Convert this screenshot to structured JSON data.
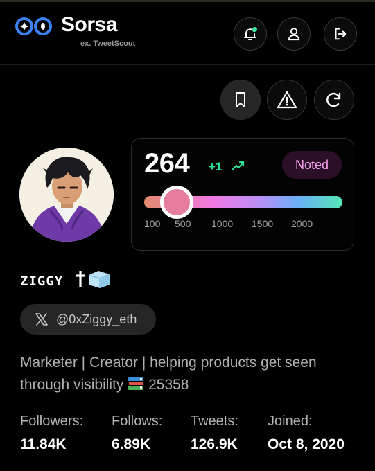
{
  "brand": {
    "name": "Sorsa",
    "subtitle": "ex. TweetScout"
  },
  "header_buttons": [
    {
      "icon": "notification-bell-icon"
    },
    {
      "icon": "user-icon"
    },
    {
      "icon": "logout-icon"
    }
  ],
  "actions": [
    {
      "icon": "bookmark-icon"
    },
    {
      "icon": "warning-icon"
    },
    {
      "icon": "refresh-icon"
    }
  ],
  "score": {
    "value": "264",
    "delta": "+1",
    "badge": "Noted",
    "level_fraction": 0.1,
    "ticks": [
      "100",
      "500",
      "1000",
      "1500",
      "2000"
    ]
  },
  "profile": {
    "display_name": "ZIGGY",
    "handle": "@0xZiggy_eth",
    "bio_line1": "Marketer | Creator | helping products get seen",
    "bio_line2_a": "through visibility",
    "bio_line2_b": "25358"
  },
  "stats": [
    {
      "label": "Followers:",
      "value": "11.84K"
    },
    {
      "label": "Follows:",
      "value": "6.89K"
    },
    {
      "label": "Tweets:",
      "value": "126.9K"
    },
    {
      "label": "Joined:",
      "value": "Oct 8, 2020"
    }
  ],
  "colors": {
    "accent_green": "#2fe39a",
    "badge_text": "#f6a0ee",
    "badge_bg": "#2a0f26",
    "thumb": "#e77d9c",
    "logo_blue": "#3b82f6"
  }
}
